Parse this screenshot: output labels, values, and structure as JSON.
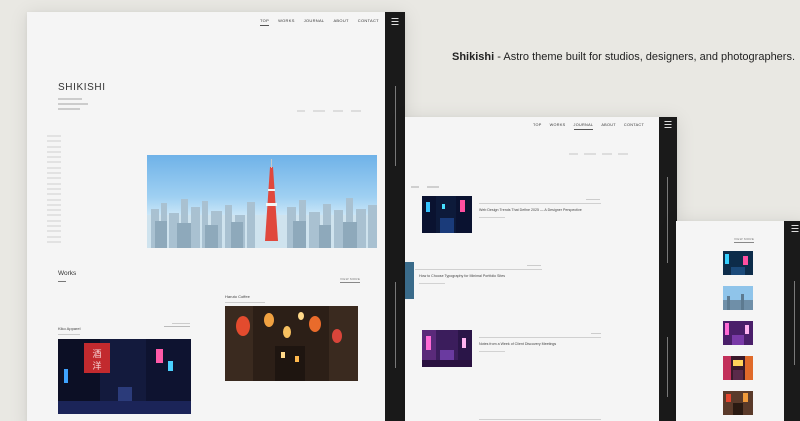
{
  "tagline": {
    "brand": "Shikishi",
    "rest": " - Astro theme built for studios, designers, and photographers."
  },
  "nav": {
    "items": [
      "TOP",
      "WORKS",
      "JOURNAL",
      "ABOUT",
      "CONTACT"
    ],
    "active_main": "TOP",
    "active_journal": "JOURNAL"
  },
  "hero": {
    "brand": "SHIKISHI"
  },
  "works": {
    "heading": "Works",
    "view_more": "VIEW MORE",
    "items": [
      {
        "title": "Kiko Apparel"
      },
      {
        "title": "Haruto Coffee"
      }
    ]
  },
  "journal": {
    "posts": [
      {
        "title": "Web Design Trends That Define 2025 — A Designer Perspective"
      },
      {
        "title": "How to Choose Typography for Minimal Portfolio Sites"
      },
      {
        "title": "Notes from a Week of Client Discovery Meetings"
      }
    ]
  },
  "thumbs": {
    "view_more": "VIEW MORE"
  },
  "colors": {
    "background": "#e9e8e3",
    "card": "#f5f5f5",
    "rail": "#1a1a1a",
    "accent": "#d9453a"
  },
  "icons": [
    "hamburger-menu-icon"
  ]
}
